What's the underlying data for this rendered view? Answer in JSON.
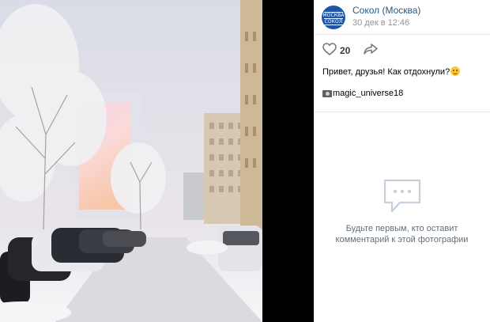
{
  "post": {
    "group_name": "Сокол (Москва)",
    "avatar_text_top": "МОСКВА",
    "avatar_text_bottom": "СОКОЛ",
    "date": "30 дек в 12:46",
    "likes": "20",
    "caption": "Привет, друзья! Как отдохнули?",
    "tag": "magic_universe18"
  },
  "comments": {
    "empty_line1": "Будьте первым, кто оставит",
    "empty_line2": "комментарий к этой фотографии"
  },
  "icons": {
    "like": "heart-icon",
    "share": "share-arrow-icon",
    "camera": "camera-icon",
    "comments": "comments-icon",
    "emoji": "smile-emoji-icon"
  },
  "colors": {
    "link": "#2a5885",
    "muted": "#939393",
    "avatar": "#1f55a6"
  }
}
